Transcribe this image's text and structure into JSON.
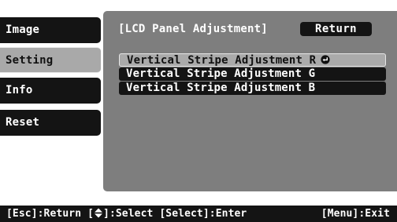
{
  "menu": {
    "items": [
      {
        "label": "Image"
      },
      {
        "label": "Setting"
      },
      {
        "label": "Info"
      },
      {
        "label": "Reset"
      }
    ]
  },
  "panel": {
    "title": "[LCD Panel Adjustment]",
    "return_label": "Return",
    "options": [
      {
        "label": "Vertical Stripe Adjustment R"
      },
      {
        "label": "Vertical Stripe Adjustment G"
      },
      {
        "label": "Vertical Stripe Adjustment B"
      }
    ],
    "selected_option": "Vertical Stripe Adjustment R",
    "selected_icon": "enter-icon"
  },
  "hints": {
    "esc": "[Esc]:Return",
    "updown_icon": "up-down-arrow-icon",
    "select": ":Select",
    "enter": "[Select]:Enter",
    "menu_exit": "[Menu]:Exit"
  },
  "colors": {
    "panel_bg": "#7e7e7e",
    "tab_bg": "#141414",
    "selected_bg": "#aaaaaa"
  }
}
